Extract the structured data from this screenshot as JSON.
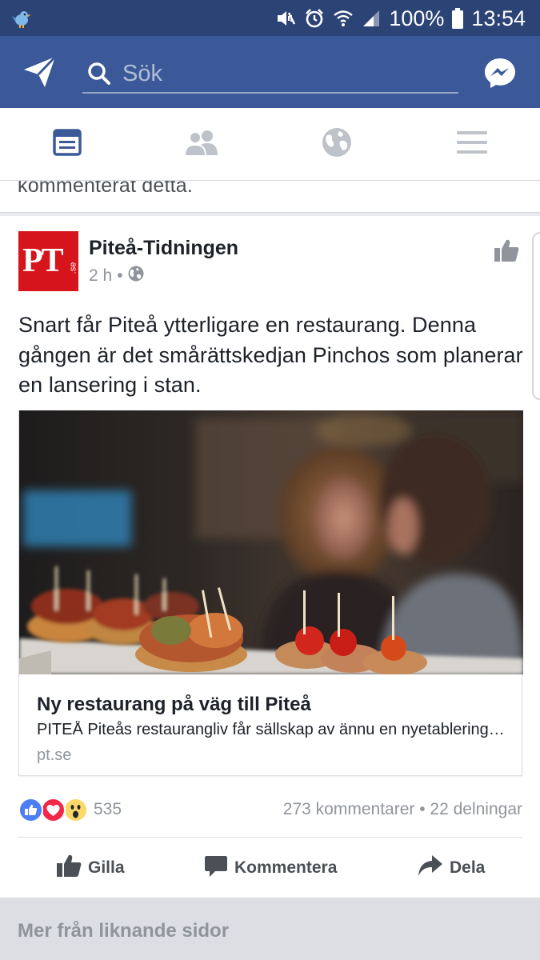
{
  "status_bar": {
    "battery": "100%",
    "time": "13:54",
    "icons": [
      "twitter-bird-icon",
      "mute-icon",
      "alarm-icon",
      "wifi-icon",
      "signal-icon",
      "battery-icon"
    ]
  },
  "app_bar": {
    "search_placeholder": "Sök",
    "icons": [
      "send-icon",
      "search-icon",
      "messenger-icon"
    ]
  },
  "tabs": [
    {
      "name": "news-feed",
      "icon": "news-feed-icon",
      "active": true
    },
    {
      "name": "friends",
      "icon": "friends-icon",
      "active": false
    },
    {
      "name": "notifications",
      "icon": "globe-icon",
      "active": false
    },
    {
      "name": "menu",
      "icon": "menu-icon",
      "active": false
    }
  ],
  "previous_story": {
    "text": "kommenterat detta."
  },
  "post": {
    "page_name": "Piteå-Tidningen",
    "time": "2 h",
    "separator": "•",
    "avatar_text": "PT",
    "avatar_sub": ".se",
    "text": "Snart får Piteå ytterligare en restaurang. Denna gången är det smårättskedjan Pinchos som planerar en lansering i stan.",
    "link": {
      "title": "Ny restaurang på väg till Piteå",
      "description": "PITEÅ Piteås restaurangliv får sällskap av ännu en nyetablering. Smårättskedjan Pinchos planerar att öppna",
      "domain": "pt.se"
    },
    "reactions": {
      "types": [
        "like",
        "love",
        "wow"
      ],
      "count": "535"
    },
    "stats": "273 kommentarer • 22 delningar",
    "actions": {
      "like": "Gilla",
      "comment": "Kommentera",
      "share": "Dela"
    }
  },
  "more_section": {
    "title": "Mer från liknande sidor"
  },
  "colors": {
    "status_bar": "#2c4376",
    "app_bar": "#3b5998",
    "active_tab": "#3b5998",
    "inactive_tab": "#bec2c9",
    "pt_red": "#d6141b",
    "like_blue": "#4c7ef5",
    "love_red": "#f0284a",
    "wow_yellow": "#fcd86a"
  }
}
